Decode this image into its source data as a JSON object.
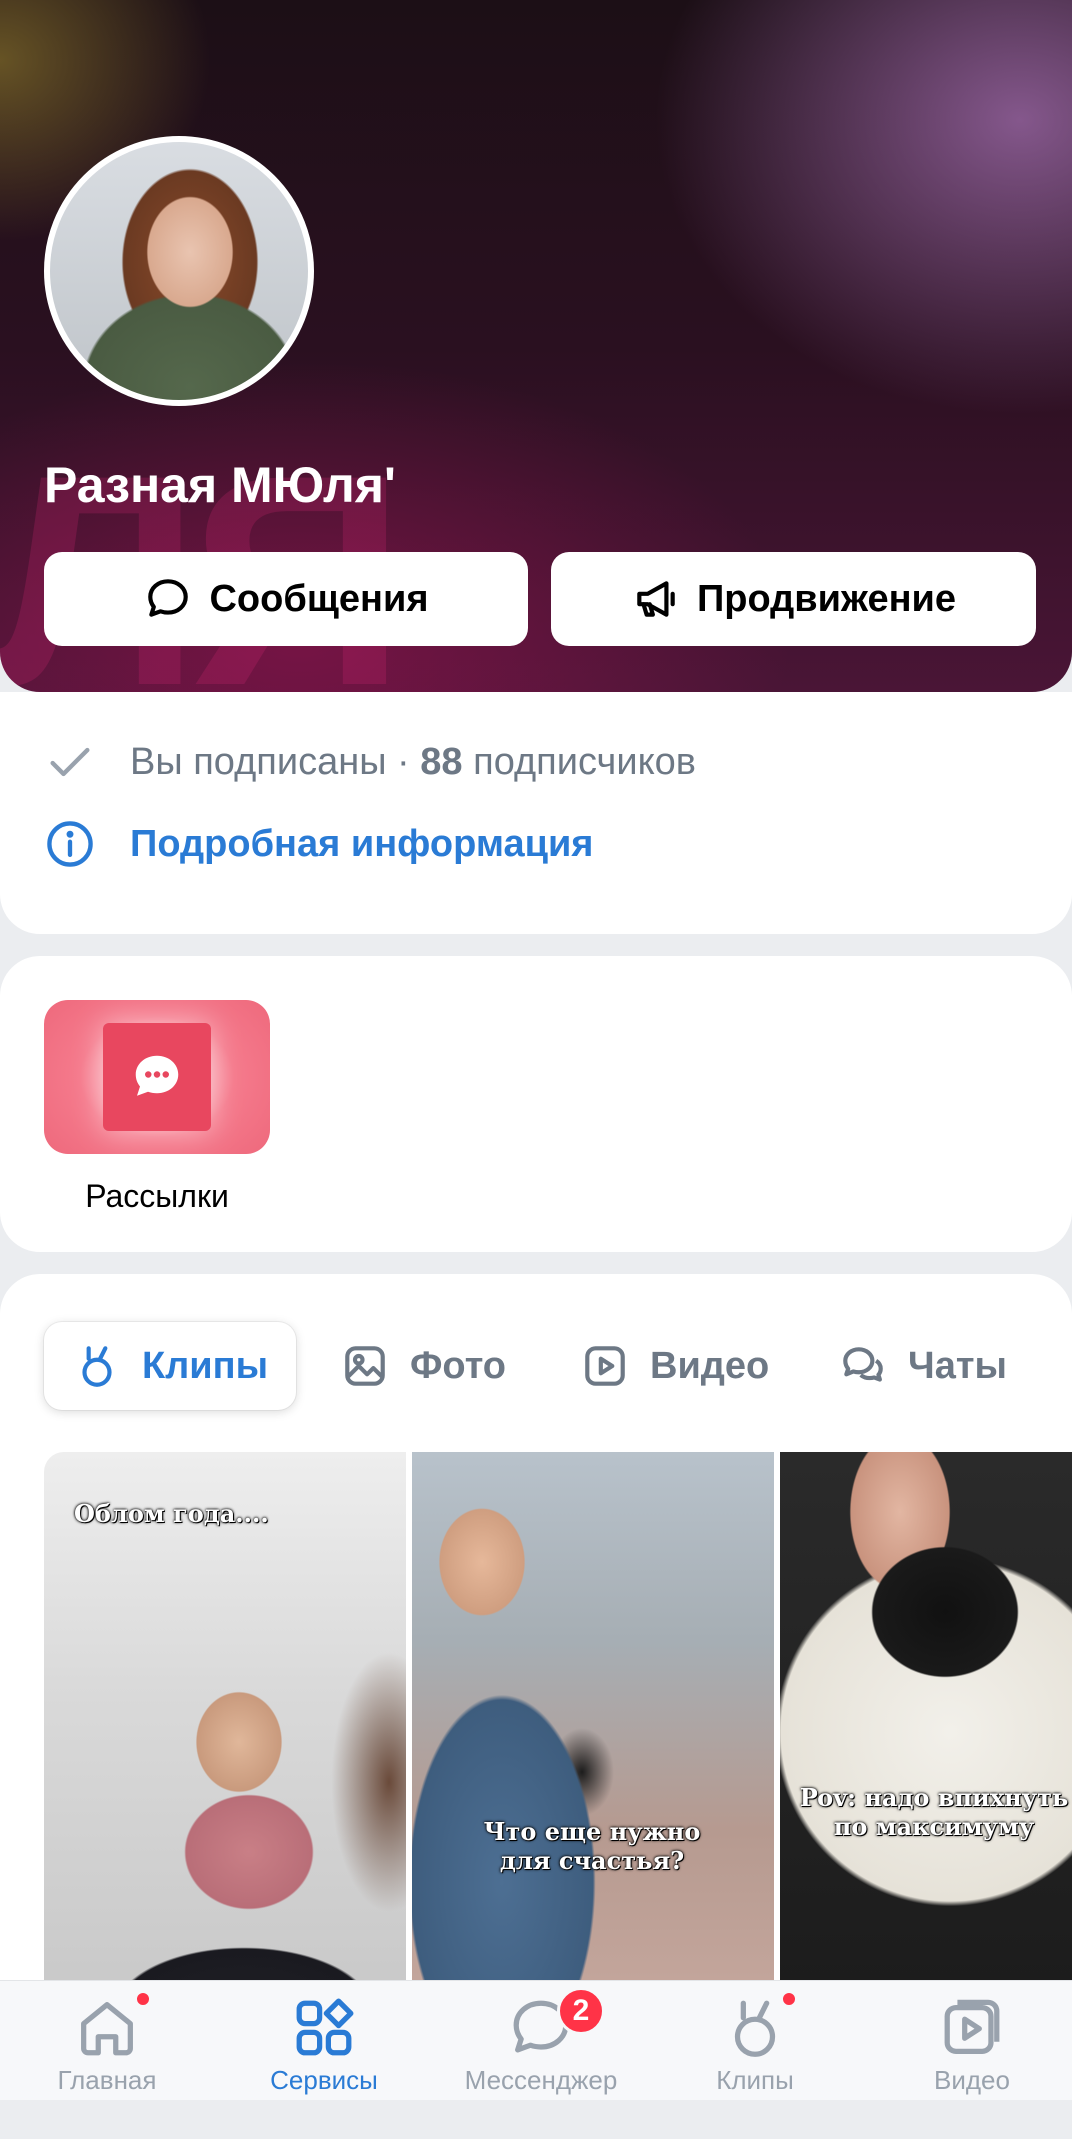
{
  "profile": {
    "name": "Разная МЮля'",
    "cover_watermark": "ЛЯ",
    "messages_button": "Сообщения",
    "promo_button": "Продвижение"
  },
  "info": {
    "subscribed_text": "Вы подписаны · ",
    "subscribers_count": "88",
    "subscribers_word": " подписчиков",
    "details_link": "Подробная информация"
  },
  "services": {
    "mailing_label": "Рассылки"
  },
  "tabs": [
    {
      "label": "Клипы",
      "icon": "clips-icon",
      "active": true
    },
    {
      "label": "Фото",
      "icon": "photo-icon",
      "active": false
    },
    {
      "label": "Видео",
      "icon": "video-icon",
      "active": false
    },
    {
      "label": "Чаты",
      "icon": "chats-icon",
      "active": false
    }
  ],
  "clips": [
    {
      "caption": "Облом года...."
    },
    {
      "caption": "Что еще нужно\nдля счастья?"
    },
    {
      "caption": "Pov: надо впихнуть\nпо максимуму"
    }
  ],
  "bottom_nav": [
    {
      "label": "Главная",
      "icon": "home-icon",
      "active": false,
      "dot": true
    },
    {
      "label": "Сервисы",
      "icon": "services-icon",
      "active": true
    },
    {
      "label": "Мессенджер",
      "icon": "messenger-icon",
      "active": false,
      "badge": "2"
    },
    {
      "label": "Клипы",
      "icon": "clips-icon",
      "active": false,
      "dot": true
    },
    {
      "label": "Видео",
      "icon": "video-icon",
      "active": false
    }
  ],
  "colors": {
    "accent": "#2a7bd5",
    "secondary_text": "#6d7885",
    "badge": "#ff3347",
    "mailing_tile": "#ef6b7e"
  }
}
